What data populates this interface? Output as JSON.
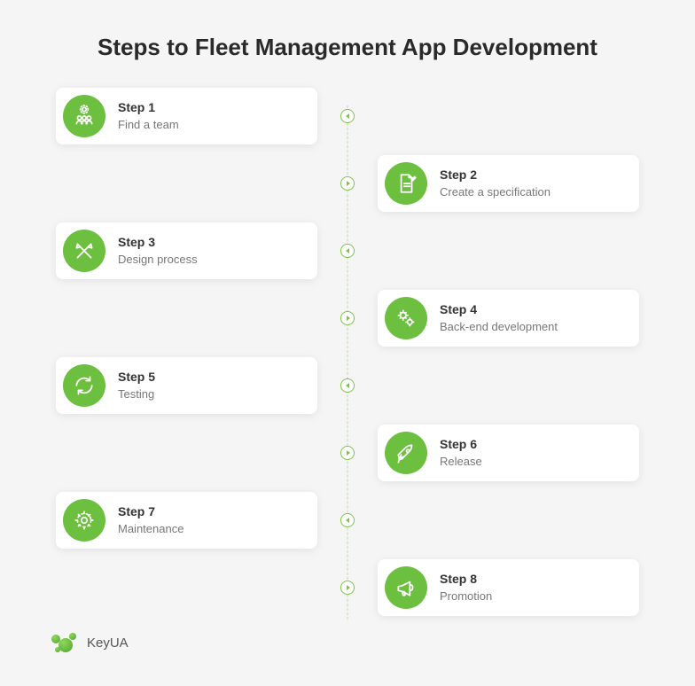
{
  "title": "Steps to Fleet Management App Development",
  "brand_name": "KeyUA",
  "steps": [
    {
      "label": "Step 1",
      "desc": "Find a team",
      "icon": "team"
    },
    {
      "label": "Step 2",
      "desc": "Create a specification",
      "icon": "spec"
    },
    {
      "label": "Step 3",
      "desc": "Design process",
      "icon": "design"
    },
    {
      "label": "Step 4",
      "desc": "Back-end development",
      "icon": "gears"
    },
    {
      "label": "Step 5",
      "desc": "Testing",
      "icon": "cycle"
    },
    {
      "label": "Step 6",
      "desc": "Release",
      "icon": "rocket"
    },
    {
      "label": "Step 7",
      "desc": "Maintenance",
      "icon": "maint"
    },
    {
      "label": "Step 8",
      "desc": "Promotion",
      "icon": "promo"
    }
  ]
}
